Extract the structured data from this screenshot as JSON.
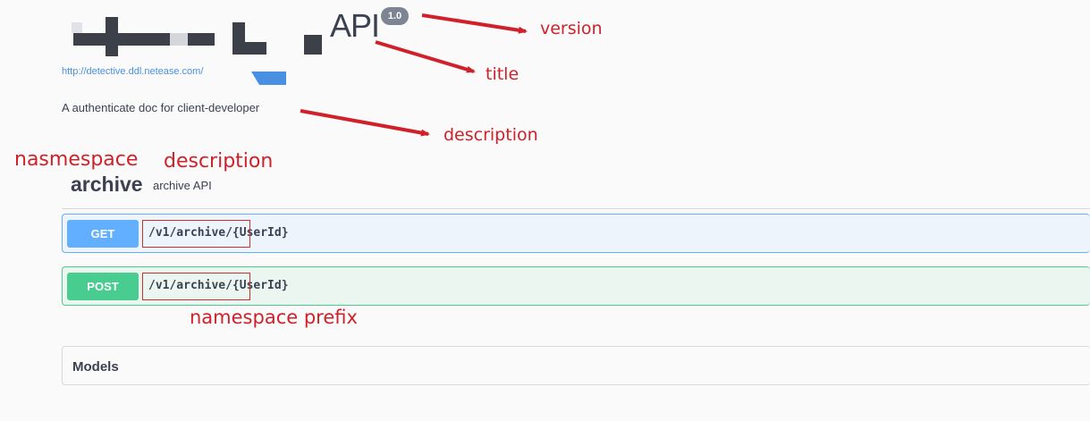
{
  "header": {
    "title": "API",
    "version": "1.0",
    "base_url": "http://detective.ddl.netease.com/",
    "description": "A authenticate doc for client-developer"
  },
  "namespace": {
    "name": "archive",
    "description": "archive API"
  },
  "operations": [
    {
      "method": "GET",
      "path": "/v1/archive/{UserId}",
      "color": "#61affe"
    },
    {
      "method": "POST",
      "path": "/v1/archive/{UserId}",
      "color": "#49cc90"
    }
  ],
  "models": {
    "label": "Models"
  },
  "annotations": {
    "version": "version",
    "title": "title",
    "description": "description",
    "namespace": "nasmespace",
    "namespace_description": "description",
    "namespace_prefix": "namespace prefix",
    "color": "#d0212a"
  }
}
